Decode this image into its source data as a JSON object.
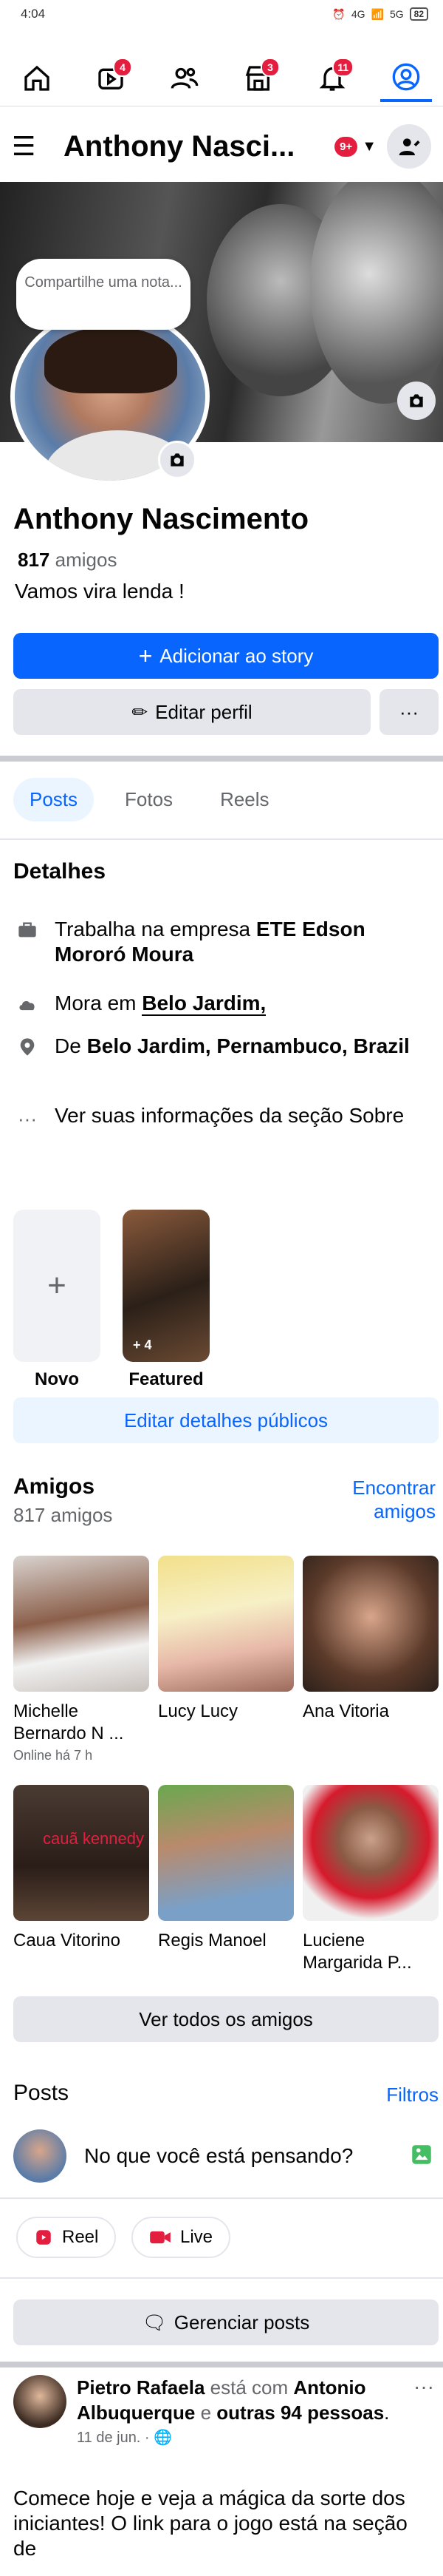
{
  "status_bar": {
    "time": "4:04",
    "signal_left": "4G",
    "signal_right": "5G",
    "battery": "82"
  },
  "nav": {
    "items": [
      {
        "name": "home",
        "badge": ""
      },
      {
        "name": "video",
        "badge": "4"
      },
      {
        "name": "friends",
        "badge": ""
      },
      {
        "name": "marketplace",
        "badge": "3"
      },
      {
        "name": "notifications",
        "badge": "11"
      },
      {
        "name": "profile",
        "badge": ""
      }
    ]
  },
  "header": {
    "name": "Anthony Nasci...",
    "notif_badge": "9+"
  },
  "profile": {
    "note_text": "Compartilhe uma nota...",
    "name": "Anthony Nascimento",
    "friends_number": "817",
    "friends_word": "amigos",
    "bio": "Vamos vira lenda !"
  },
  "actions": {
    "add_story": "Adicionar ao story",
    "edit_profile": "Editar perfil",
    "more": "···"
  },
  "tabs": [
    "Posts",
    "Fotos",
    "Reels"
  ],
  "details": {
    "title": "Detalhes",
    "work_prefix": "Trabalha na empresa ",
    "work_place": "ETE Edson Mororó Moura",
    "lives_prefix": "Mora em ",
    "lives_place": "Belo Jardim,",
    "from_prefix": "De ",
    "from_place": "Belo Jardim, Pernambuco, Brazil",
    "about_link": "Ver suas informações da seção Sobre"
  },
  "highlights": {
    "new_label": "Novo",
    "featured_label": "Featured",
    "featured_count": "+ 4"
  },
  "edit_public": "Editar detalhes públicos",
  "friends_section": {
    "title": "Amigos",
    "count": "817 amigos",
    "find_link": "Encontrar amigos",
    "list": [
      {
        "name": "Michelle Bernardo N ...",
        "status": "Online há 7 h"
      },
      {
        "name": "Lucy Lucy",
        "status": ""
      },
      {
        "name": "Ana Vitoria",
        "status": ""
      },
      {
        "name": "Caua Vitorino",
        "status": ""
      },
      {
        "name": "Regis Manoel",
        "status": ""
      },
      {
        "name": "Luciene Margarida P...",
        "status": ""
      }
    ],
    "photo_caption": "cauã kennedy",
    "see_all": "Ver todos os amigos"
  },
  "posts_section": {
    "title": "Posts",
    "filters": "Filtros",
    "composer_placeholder": "No que você está pensando?",
    "reel": "Reel",
    "live": "Live",
    "manage": "Gerenciar posts"
  },
  "post": {
    "author": "Pietro Rafaela",
    "with_text": " está com ",
    "tagged": "Antonio Albuquerque",
    "and_text": " e ",
    "others": "outras 94 pessoas",
    "period": ".",
    "date": "11 de jun. · ",
    "body": "Comece hoje e veja a mágica da sorte dos iniciantes! O link para o jogo está na seção de"
  },
  "colors": {
    "accent": "#0866ff",
    "badge": "#e41e3f",
    "muted": "#65676b",
    "gray_btn": "#e4e6eb"
  }
}
